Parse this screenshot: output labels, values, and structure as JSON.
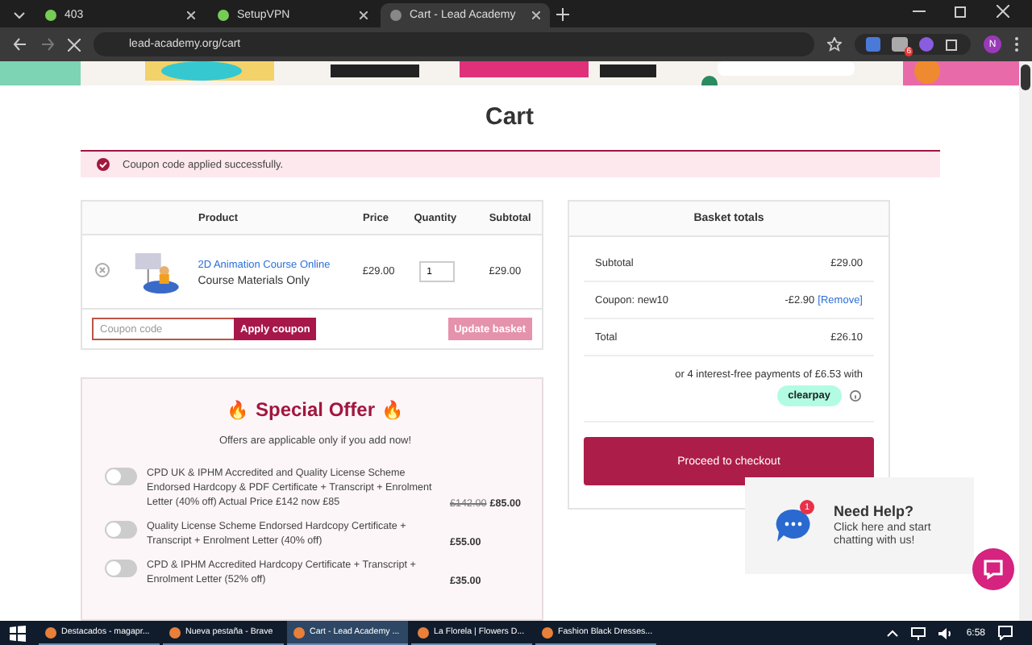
{
  "browser": {
    "tabs": [
      {
        "title": "403",
        "selected": false
      },
      {
        "title": "SetupVPN",
        "selected": false
      },
      {
        "title": "Cart - Lead Academy",
        "selected": true
      }
    ],
    "url": "lead-academy.org/cart",
    "profile": "N",
    "extension_badge": "6"
  },
  "page": {
    "title": "Cart",
    "notice": "Coupon code applied successfully.",
    "cart": {
      "columns": [
        "Product",
        "Price",
        "Quantity",
        "Subtotal"
      ],
      "items": [
        {
          "name": "2D Animation Course Online",
          "option": "Course Materials Only",
          "price": "£29.00",
          "quantity": "1",
          "subtotal": "£29.00"
        }
      ],
      "coupon_placeholder": "Coupon code",
      "apply_label": "Apply coupon",
      "update_label": "Update basket",
      "update_disabled": true
    },
    "totals": {
      "title": "Basket totals",
      "rows": [
        {
          "label": "Subtotal",
          "value": "£29.00"
        },
        {
          "label": "Coupon: new10",
          "value": "-£2.90",
          "link": "[Remove]"
        },
        {
          "label": "Total",
          "value": "£26.10"
        }
      ],
      "installments": "or 4 interest-free payments of £6.53 with",
      "clearpay": "clearpay",
      "checkout_label": "Proceed to checkout"
    },
    "offer": {
      "flame": "🔥",
      "title": "Special Offer",
      "subtitle": "Offers are applicable only if you add now!",
      "items": [
        {
          "text": "CPD UK & IPHM Accredited and Quality License Scheme Endorsed Hardcopy & PDF Certificate + Transcript + Enrolment Letter (40% off) Actual Price £142 now £85",
          "old_price": "£142.00",
          "price": "£85.00",
          "on": false
        },
        {
          "text": "Quality License Scheme Endorsed Hardcopy Certificate + Transcript + Enrolment Letter (40% off)",
          "price": "£55.00",
          "on": false
        },
        {
          "text": "CPD & IPHM Accredited Hardcopy Certificate + Transcript + Enrolment Letter (52% off)",
          "price": "£35.00",
          "on": false
        }
      ]
    },
    "chat": {
      "title": "Need Help?",
      "text": "Click here and start chatting with us!",
      "badge": "1"
    }
  },
  "taskbar": {
    "items": [
      {
        "title": "Destacados - magapr...",
        "selected": false
      },
      {
        "title": "Nueva pestaña - Brave",
        "selected": false
      },
      {
        "title": "Cart - Lead Academy ...",
        "selected": true
      },
      {
        "title": "La Florela | Flowers D...",
        "selected": false
      },
      {
        "title": "Fashion Black Dresses...",
        "selected": false
      }
    ],
    "time": "6:58"
  }
}
